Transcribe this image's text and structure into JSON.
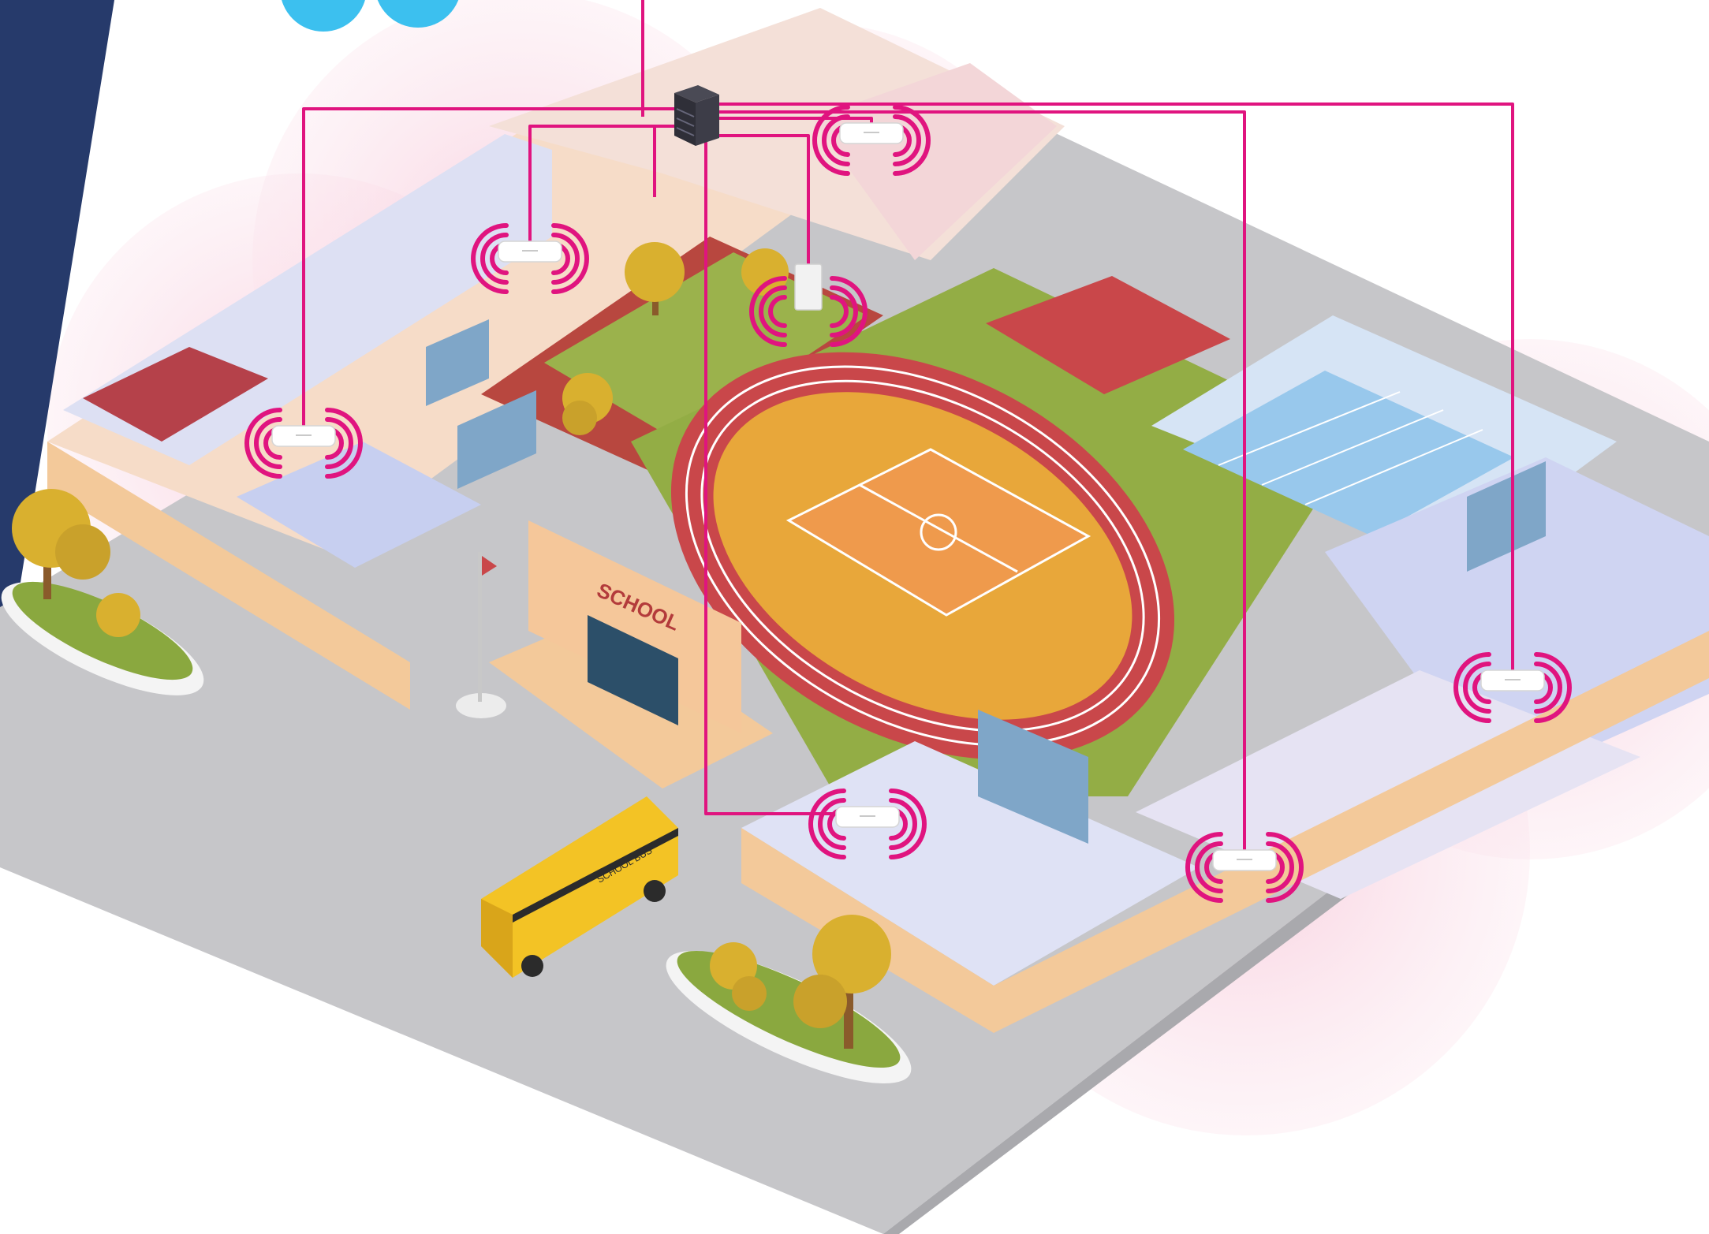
{
  "sign": {
    "text": "SCHOOL"
  },
  "bus": {
    "text": "SCHOOL BUS"
  },
  "colors": {
    "cable": "#e0147f",
    "signal": "#e0147f",
    "side_band": "#263a6b",
    "logo": "#3cc0ef",
    "ground": "#c9c9cb",
    "track": "#c9474a",
    "field": "#e6a437",
    "grass": "#8caa3f",
    "pool": "#a9d3ef"
  },
  "icons": {
    "core_switch": "server-rack-icon",
    "access_point": "wireless-access-point-icon",
    "wall_access_point": "wall-mounted-access-point-icon",
    "signal": "wifi-signal-icon",
    "tree": "tree-icon",
    "bus": "school-bus-icon",
    "flag": "flagpole-icon"
  }
}
